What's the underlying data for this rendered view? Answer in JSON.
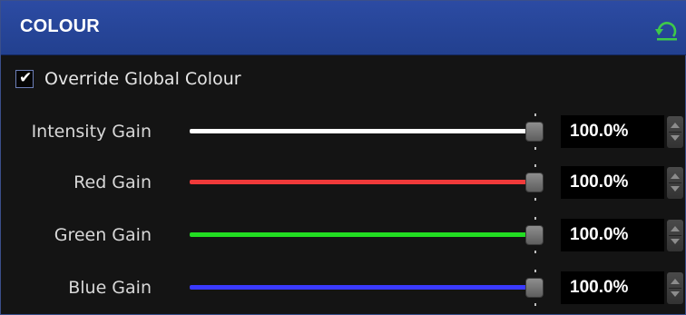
{
  "panel": {
    "title": "COLOUR",
    "reset_icon": "reset-arrow-icon"
  },
  "override": {
    "label": "Override Global Colour",
    "checked": true,
    "check_glyph": "✔"
  },
  "sliders": [
    {
      "label": "Intensity Gain",
      "value": "100.0%",
      "level": 1.0,
      "color": "#ffffff"
    },
    {
      "label": "Red Gain",
      "value": "100.0%",
      "level": 1.0,
      "color": "#f03a3a"
    },
    {
      "label": "Green Gain",
      "value": "100.0%",
      "level": 1.0,
      "color": "#22dd22"
    },
    {
      "label": "Blue Gain",
      "value": "100.0%",
      "level": 1.0,
      "color": "#3a3aff"
    }
  ],
  "colors": {
    "header": "#2a479d",
    "background": "#141414",
    "value_box": "#000000"
  }
}
